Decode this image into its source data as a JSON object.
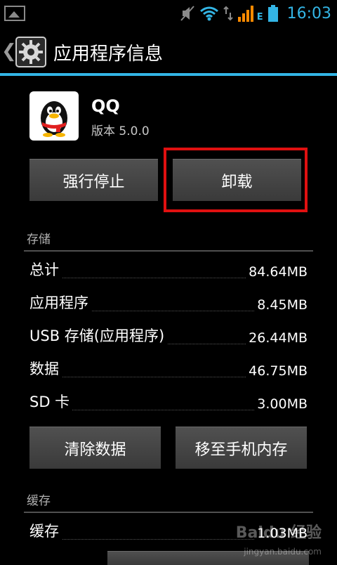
{
  "status_bar": {
    "time": "16:03",
    "network_type": "E",
    "icons": [
      "picture-icon",
      "mute-icon",
      "wifi-icon",
      "signal-icon",
      "battery-icon"
    ]
  },
  "header": {
    "title": "应用程序信息"
  },
  "app": {
    "name": "QQ",
    "version": "版本 5.0.0"
  },
  "buttons": {
    "force_stop": "强行停止",
    "uninstall": "卸载",
    "clear_data": "清除数据",
    "move_to_phone": "移至手机内存"
  },
  "storage": {
    "section_title": "存储",
    "rows": [
      {
        "label": "总计",
        "value": "84.64MB"
      },
      {
        "label": "应用程序",
        "value": "8.45MB"
      },
      {
        "label": "USB 存储(应用程序)",
        "value": "26.44MB"
      },
      {
        "label": "数据",
        "value": "46.75MB"
      },
      {
        "label": "SD 卡",
        "value": "3.00MB"
      }
    ]
  },
  "cache": {
    "section_title": "缓存",
    "rows": [
      {
        "label": "缓存",
        "value": "1.03MB"
      }
    ]
  },
  "watermark": {
    "text": "Baidu 经验",
    "url": "jingyan.baidu.com"
  },
  "colors": {
    "accent": "#33b5e5",
    "highlight": "#e01010",
    "network_orange": "#ff8a00"
  }
}
